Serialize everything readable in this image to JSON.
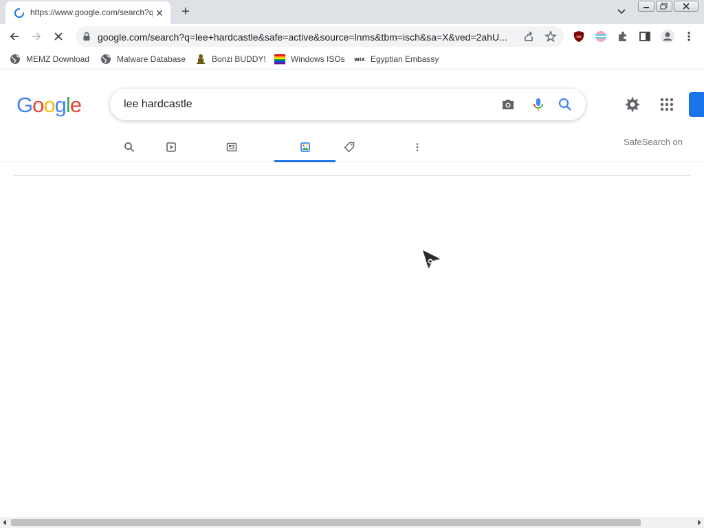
{
  "browser": {
    "tab": {
      "title": "https://www.google.com/search?q=lee+hardcastle",
      "close_glyph": "✕"
    },
    "new_tab_glyph": "+",
    "address": {
      "url": "google.com/search?q=lee+hardcastle&safe=active&source=lnms&tbm=isch&sa=X&ved=2ahU..."
    },
    "bookmarks": [
      {
        "label": "MEMZ Download",
        "icon": "globe-icon"
      },
      {
        "label": "Malware Database",
        "icon": "globe-icon"
      },
      {
        "label": "Bonzi BUDDY!",
        "icon": "bonzi-icon"
      },
      {
        "label": "Windows ISOs",
        "icon": "rainbow-flag-icon"
      },
      {
        "label": "Egyptian Embassy",
        "icon": "wix-icon",
        "icon_text": "WiX"
      }
    ],
    "state": "loading"
  },
  "google": {
    "logo_letters": [
      {
        "ch": "G",
        "color": "#4285F4"
      },
      {
        "ch": "o",
        "color": "#EA4335"
      },
      {
        "ch": "o",
        "color": "#FBBC05"
      },
      {
        "ch": "g",
        "color": "#4285F4"
      },
      {
        "ch": "l",
        "color": "#34A853"
      },
      {
        "ch": "e",
        "color": "#EA4335"
      }
    ],
    "search": {
      "query": "lee hardcastle"
    },
    "tabs": [
      {
        "name": "all",
        "icon": "search-icon"
      },
      {
        "name": "videos",
        "icon": "video-icon"
      },
      {
        "name": "news",
        "icon": "news-icon"
      },
      {
        "name": "images",
        "icon": "image-icon",
        "active": true
      },
      {
        "name": "shopping",
        "icon": "tag-icon"
      },
      {
        "name": "more",
        "icon": "more-vertical-icon"
      }
    ],
    "safesearch": "SafeSearch on"
  },
  "colors": {
    "accent": "#1a73e8",
    "tabstrip": "#dee1e6",
    "omnibox": "#f1f3f4"
  }
}
